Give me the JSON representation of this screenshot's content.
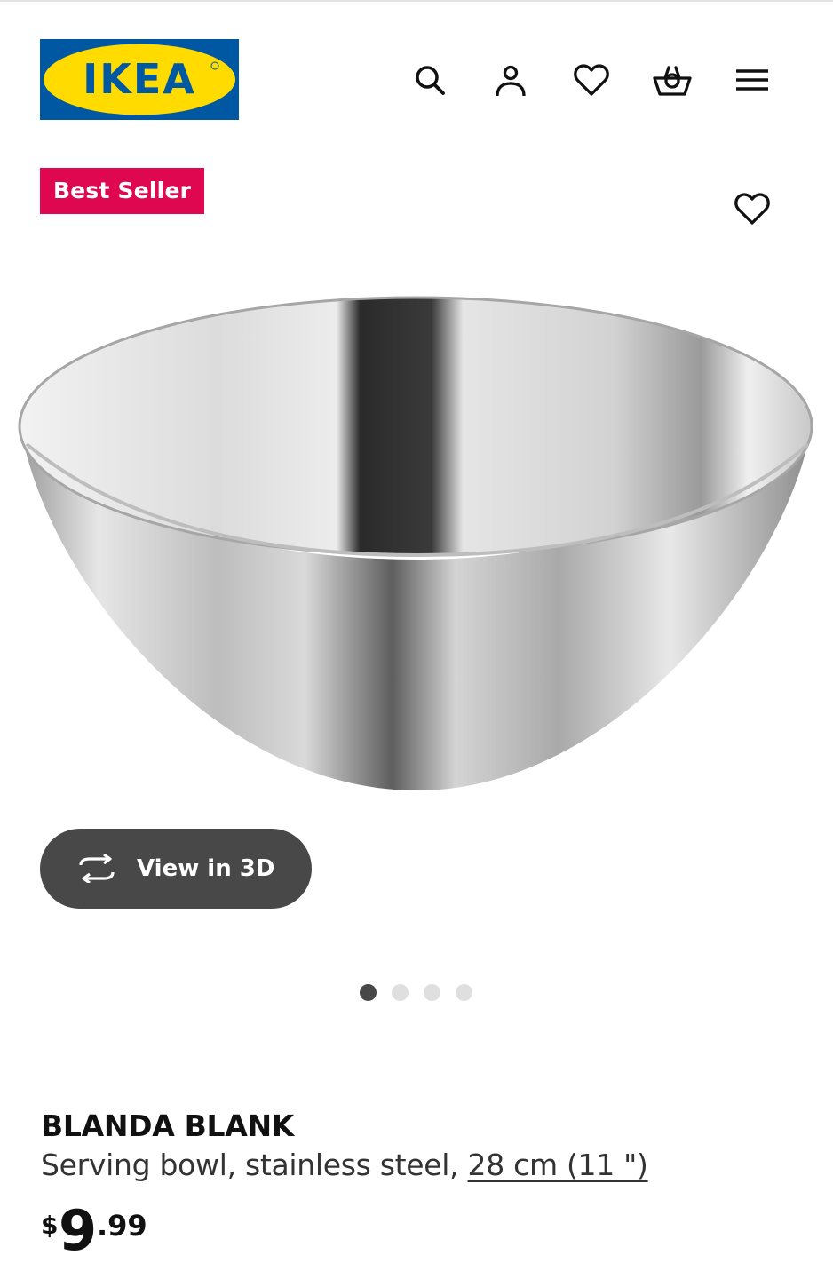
{
  "header": {
    "logo_text": "IKEA",
    "logo_colors": {
      "background": "#0058a3",
      "oval": "#ffdb00",
      "text": "#0058a3"
    },
    "icons": [
      "search-icon",
      "account-icon",
      "favorites-icon",
      "cart-icon",
      "menu-icon"
    ]
  },
  "badge": {
    "label": "Best Seller",
    "color": "#e00751"
  },
  "product": {
    "name": "BLANDA BLANK",
    "description": "Serving bowl, stainless steel, ",
    "size_link": "28 cm (11 \")",
    "price": {
      "currency": "$",
      "integer": "9",
      "decimal": ".99"
    }
  },
  "gallery": {
    "view3d_label": "View in 3D",
    "total_images": 4,
    "active_index": 0
  }
}
